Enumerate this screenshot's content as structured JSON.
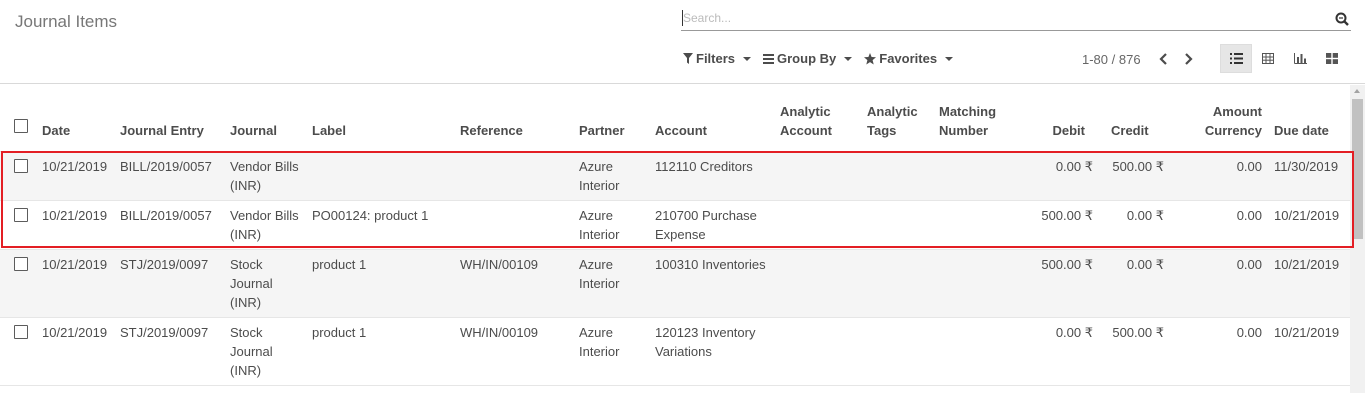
{
  "header": {
    "title": "Journal Items"
  },
  "search": {
    "placeholder": "Search..."
  },
  "filters": {
    "filters_label": "Filters",
    "group_by_label": "Group By",
    "favorites_label": "Favorites"
  },
  "pager": {
    "value": "1-80 / 876"
  },
  "table": {
    "columns": {
      "date": "Date",
      "journal_entry": "Journal Entry",
      "journal": "Journal",
      "label": "Label",
      "reference": "Reference",
      "partner": "Partner",
      "account": "Account",
      "analytic_account": "Analytic Account",
      "analytic_tags": "Analytic Tags",
      "matching_number": "Matching Number",
      "debit": "Debit",
      "credit": "Credit",
      "amount_currency": "Amount Currency",
      "due_date": "Due date"
    },
    "rows": [
      {
        "date": "10/21/2019",
        "journal_entry": "BILL/2019/0057",
        "journal": "Vendor Bills (INR)",
        "label": "",
        "reference": "",
        "partner": "Azure Interior",
        "account": "112110 Creditors",
        "analytic_account": "",
        "analytic_tags": "",
        "matching_number": "",
        "debit": "0.00 ₹",
        "credit": "500.00 ₹",
        "amount_currency": "0.00",
        "due_date": "11/30/2019"
      },
      {
        "date": "10/21/2019",
        "journal_entry": "BILL/2019/0057",
        "journal": "Vendor Bills (INR)",
        "label": "PO00124: product 1",
        "reference": "",
        "partner": "Azure Interior",
        "account": "210700 Purchase Expense",
        "analytic_account": "",
        "analytic_tags": "",
        "matching_number": "",
        "debit": "500.00 ₹",
        "credit": "0.00 ₹",
        "amount_currency": "0.00",
        "due_date": "10/21/2019"
      },
      {
        "date": "10/21/2019",
        "journal_entry": "STJ/2019/0097",
        "journal": "Stock Journal (INR)",
        "label": "product 1",
        "reference": "WH/IN/00109",
        "partner": "Azure Interior",
        "account": "100310 Inventories",
        "analytic_account": "",
        "analytic_tags": "",
        "matching_number": "",
        "debit": "500.00 ₹",
        "credit": "0.00 ₹",
        "amount_currency": "0.00",
        "due_date": "10/21/2019"
      },
      {
        "date": "10/21/2019",
        "journal_entry": "STJ/2019/0097",
        "journal": "Stock Journal (INR)",
        "label": "product 1",
        "reference": "WH/IN/00109",
        "partner": "Azure Interior",
        "account": "120123 Inventory Variations",
        "analytic_account": "",
        "analytic_tags": "",
        "matching_number": "",
        "debit": "0.00 ₹",
        "credit": "500.00 ₹",
        "amount_currency": "0.00",
        "due_date": "10/21/2019"
      }
    ]
  },
  "icons": {
    "search": "search-icon",
    "filter": "funnel-icon",
    "group_by": "bars-icon",
    "favorites": "star-icon",
    "prev": "chevron-left-icon",
    "next": "chevron-right-icon",
    "list_view": "list-view-icon",
    "pivot_view": "table-icon",
    "graph_view": "bar-chart-icon",
    "kanban_view": "grid-icon"
  },
  "colors": {
    "highlight": "#e31e24",
    "row_stripe": "#f5f5f5"
  }
}
